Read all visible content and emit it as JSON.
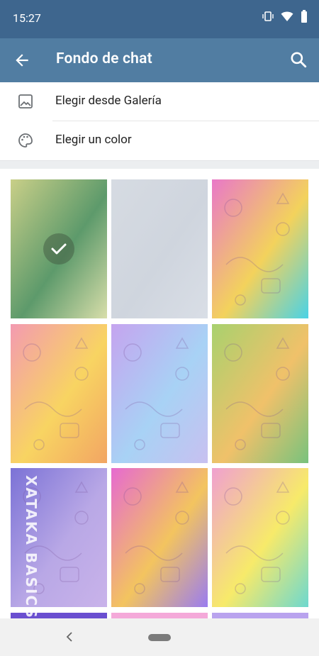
{
  "status_bar": {
    "time": "15:27",
    "icons": [
      "vibrate-icon",
      "wifi-icon",
      "battery-icon"
    ]
  },
  "app_bar": {
    "title": "Fondo de chat",
    "back_icon": "arrow-left-icon",
    "search_icon": "search-icon"
  },
  "menu": {
    "items": [
      {
        "label": "Elegir desde Galería",
        "icon": "image-icon"
      },
      {
        "label": "Elegir un color",
        "icon": "palette-icon"
      }
    ]
  },
  "wallpapers": {
    "selected_index": 0,
    "items": [
      {
        "name": "green-gradient",
        "colors": [
          "#c9cf88",
          "#5d9a6b",
          "#d8deaa"
        ]
      },
      {
        "name": "light-gray",
        "colors": [
          "#d6dbe2",
          "#cfd5de",
          "#d9dee6"
        ]
      },
      {
        "name": "rainbow-animals",
        "colors": [
          "#e978c8",
          "#f3d25c",
          "#4ad2e6"
        ]
      },
      {
        "name": "pink-yellow-sweets",
        "colors": [
          "#f39ab1",
          "#f8d462",
          "#f2a563"
        ]
      },
      {
        "name": "blue-white-space",
        "colors": [
          "#c5a4ef",
          "#a8d2f5",
          "#c8c0f0"
        ]
      },
      {
        "name": "green-orange-food",
        "colors": [
          "#a8d16e",
          "#f0c16a",
          "#78c27d"
        ]
      },
      {
        "name": "purple-space",
        "colors": [
          "#7b72d6",
          "#b9a8e6",
          "#c9b3ea"
        ]
      },
      {
        "name": "pink-orange-fire",
        "colors": [
          "#e66ad0",
          "#f3c45f",
          "#9a7cf0"
        ]
      },
      {
        "name": "rainbow-math",
        "colors": [
          "#f0a0d0",
          "#f7ea6a",
          "#6dd8cf"
        ]
      }
    ],
    "partial_row_colors": [
      "#6a4fd0",
      "#f4a9d9",
      "#b9a3ee"
    ]
  },
  "watermark": {
    "text": "XATAKA BASICS"
  },
  "nav_bar": {
    "back_icon": "nav-back-icon",
    "home_icon": "home-pill-icon"
  }
}
